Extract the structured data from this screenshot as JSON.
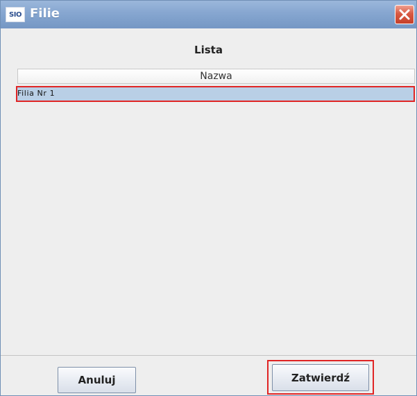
{
  "window": {
    "title": "Filie",
    "app_icon_text": "SIO",
    "close_icon": "close-icon"
  },
  "panel": {
    "title": "Lista"
  },
  "table": {
    "columns": [
      "Nazwa"
    ],
    "rows": [
      {
        "nazwa": "Filia Nr 1",
        "selected": true
      }
    ]
  },
  "buttons": {
    "cancel_label": "Anuluj",
    "confirm_label": "Zatwierdź"
  },
  "colors": {
    "titlebar": "#86a6d0",
    "selection": "#b9cfe6",
    "highlight": "#e02424"
  }
}
